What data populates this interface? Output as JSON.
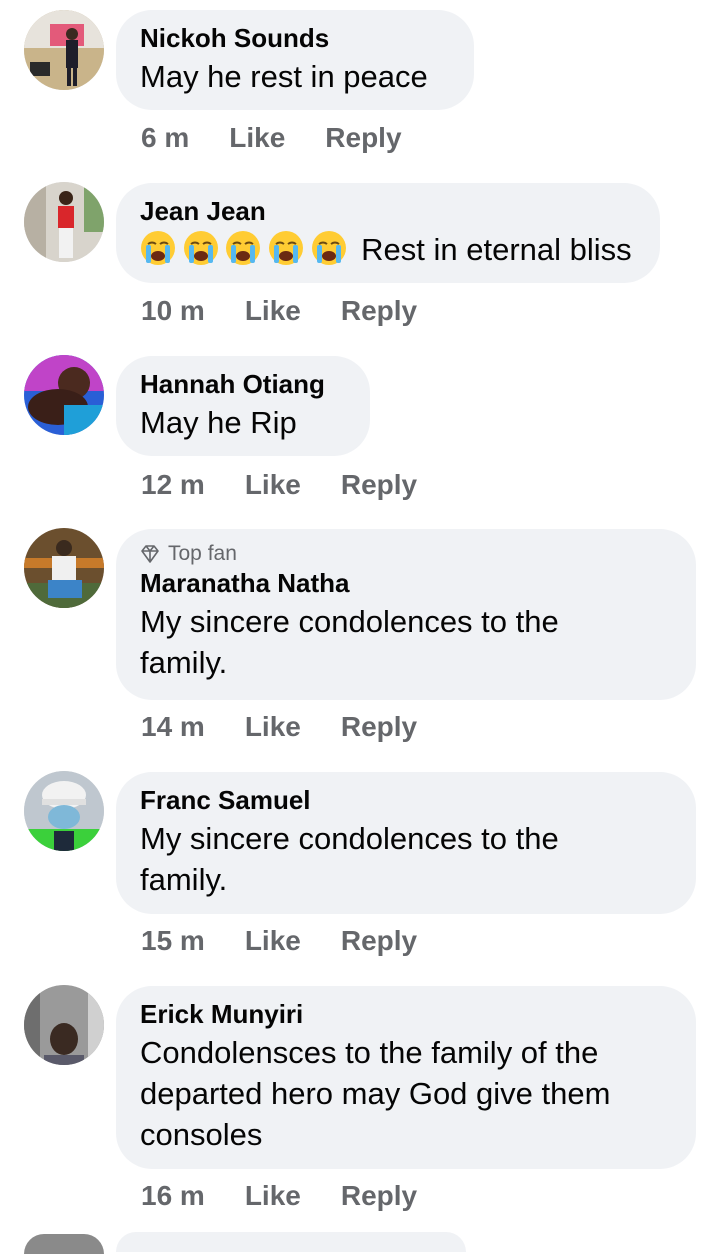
{
  "comments": [
    {
      "avatar_icon": "user-photo-avatar",
      "top_fan": null,
      "author": "Nickoh Sounds",
      "text": "May he rest in peace",
      "time": "6 m",
      "like": "Like",
      "reply": "Reply"
    },
    {
      "avatar_icon": "user-photo-avatar",
      "top_fan": null,
      "author": "Jean Jean",
      "emoji_icon": "crying-face-emoji",
      "emoji_count": 5,
      "text": "Rest in eternal bliss",
      "time": "10 m",
      "like": "Like",
      "reply": "Reply"
    },
    {
      "avatar_icon": "user-photo-avatar",
      "top_fan": null,
      "author": "Hannah Otiang",
      "text": "May he Rip",
      "time": "12 m",
      "like": "Like",
      "reply": "Reply"
    },
    {
      "avatar_icon": "user-photo-avatar",
      "top_fan": "Top fan",
      "top_fan_icon": "diamond-icon",
      "author": "Maranatha Natha",
      "text_lines": [
        "My sincere condolences to the",
        "family."
      ],
      "time": "14 m",
      "like": "Like",
      "reply": "Reply"
    },
    {
      "avatar_icon": "user-photo-avatar",
      "top_fan": null,
      "author": "Franc Samuel",
      "text_lines": [
        "My sincere condolences to the",
        "family."
      ],
      "time": "15 m",
      "like": "Like",
      "reply": "Reply"
    },
    {
      "avatar_icon": "user-photo-avatar",
      "top_fan": null,
      "author": "Erick Munyiri",
      "text_lines": [
        "Condolensces to the family of the",
        "departed hero may God give them",
        "consoles"
      ],
      "time": "16 m",
      "like": "Like",
      "reply": "Reply"
    }
  ],
  "colors": {
    "bubble": "#f0f2f5",
    "secondary_text": "#65676b",
    "primary_text": "#050505"
  }
}
